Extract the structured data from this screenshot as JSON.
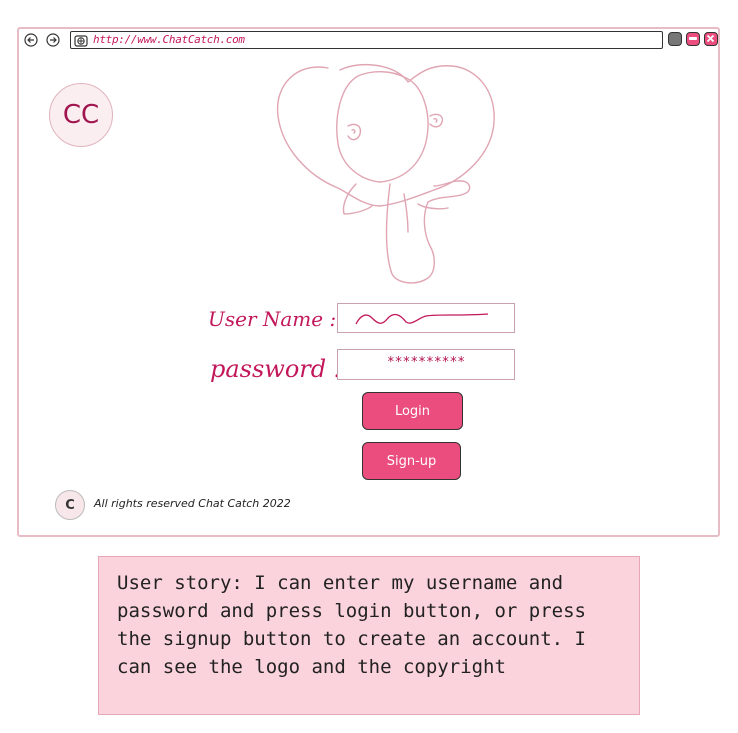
{
  "browser": {
    "url": "http://www.ChatCatch.com",
    "icons": [
      "back-arrow-icon",
      "forward-arrow-icon",
      "globe-icon",
      "minimize-icon",
      "maximize-icon",
      "close-icon"
    ],
    "controls": {
      "colors": {
        "minimize": "#777777",
        "maximize": "#ea4d7e",
        "close": "#ea4d7e"
      }
    }
  },
  "app": {
    "logo_text": "CC",
    "username_label": "User Name :",
    "password_label": "password :",
    "password_value": "**********",
    "login_button": "Login",
    "signup_button": "Sign-up",
    "footer": {
      "badge": "C",
      "copyright": "All rights reserved Chat Catch 2022"
    }
  },
  "note": {
    "text": "User story: I can enter my username and password and press login button, or press the signup button to create an account. I can see the logo and the copyright"
  },
  "colors": {
    "accent": "#ea4d7e",
    "label": "#c2185b",
    "note_bg": "#fbd3dc",
    "frame": "#e8bcc5"
  }
}
